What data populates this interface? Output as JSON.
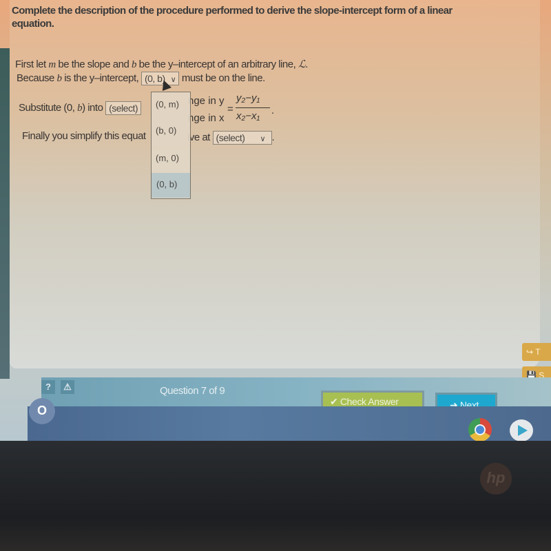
{
  "question": {
    "title": "Complete the description of the procedure performed to derive the slope-intercept form of a linear equation.",
    "line1": {
      "text_a": "First let ",
      "var_m": "m",
      "text_b": " be the slope and ",
      "var_b": "b",
      "text_c": " be the y–intercept of an arbitrary line, ",
      "var_l": "ℒ",
      "text_d": "."
    },
    "line2": {
      "text_a": "Because ",
      "var_b": "b",
      "text_b": " is the y–intercept,",
      "select_value": "(0, b)",
      "text_c": "must be on the line."
    },
    "line3": {
      "text_a": "Substitute (0, ",
      "var_b": "b",
      "text_b": ") into",
      "select_value": "(select)",
      "partial_text_top": "nge in y",
      "partial_text_bottom": "nge in x",
      "equals": "=",
      "numerator": "y₂−y₁",
      "denominator": "x₂−x₁",
      "period": "."
    },
    "line4": {
      "text_a": "Finally you simplify this equat",
      "text_b": "ive at",
      "select_value": "(select)",
      "period": "."
    },
    "dropdown": {
      "options": [
        "(0, m)",
        "(b, 0)",
        "(m, 0)",
        "(0, b)"
      ],
      "highlighted": "(0, b)"
    }
  },
  "footer": {
    "help_icon": "?",
    "warning_icon": "⚠",
    "question_counter": "Question 7 of 9",
    "check_answer_label": "Check Answer",
    "check_icon": "✔",
    "next_label": "Next",
    "next_icon": "➜"
  },
  "side_buttons": [
    {
      "icon": "↪",
      "label": "T"
    },
    {
      "icon": "💾",
      "label": "S"
    }
  ],
  "taskbar": {
    "launcher_icon": "O",
    "apps": [
      "chrome",
      "play-store"
    ]
  },
  "bezel": {
    "logo": "hp"
  },
  "colors": {
    "check_answer": "#a8bf52",
    "next": "#1fa8cf",
    "side_button": "#d9a848",
    "footer_bar": "#86b3c4",
    "taskbar": "#587aa0"
  }
}
